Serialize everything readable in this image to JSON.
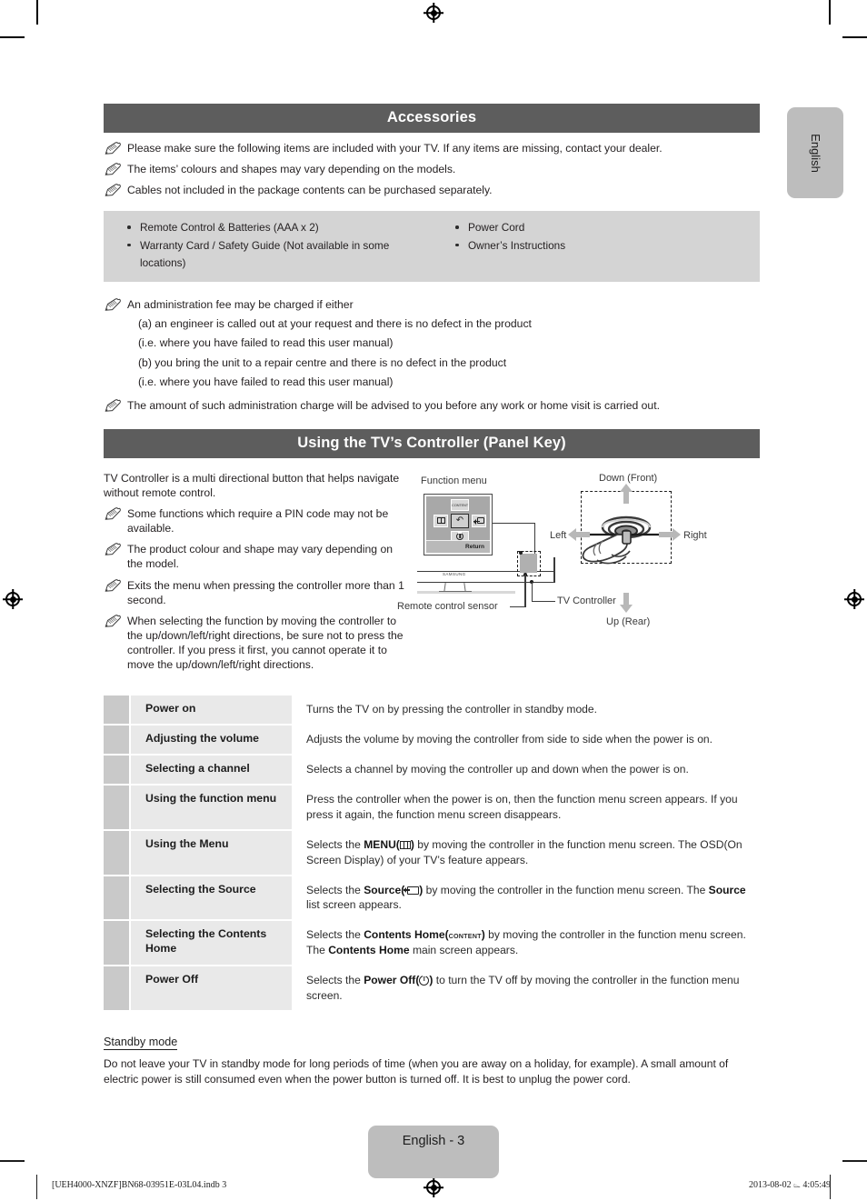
{
  "language_tab": "English",
  "accessories": {
    "title": "Accessories",
    "notes": [
      "Please make sure the following items are included with your TV. If any items are missing, contact your dealer.",
      "The items’ colours and shapes may vary depending on the models.",
      "Cables not included in the package contents can be purchased separately."
    ],
    "items_left": [
      "Remote Control & Batteries (AAA x 2)",
      "Warranty Card / Safety Guide (Not available in some locations)"
    ],
    "items_right": [
      "Power Cord",
      "Owner’s Instructions"
    ],
    "admin_fee_note": "An administration fee may be charged if either",
    "admin_fee_lines": [
      "(a) an engineer is called out at your request and there is no defect in the product",
      "(i.e. where you have failed to read this user manual)",
      "(b) you bring the unit to a repair centre and there is no defect in the product",
      "(i.e. where you have failed to read this user manual)"
    ],
    "admin_charge_note": "The amount of such administration charge will be advised to you before any work or home visit is carried out."
  },
  "controller": {
    "title": "Using the TV’s Controller (Panel Key)",
    "lead": "TV Controller is a multi directional button that helps navigate without remote control.",
    "notes": [
      "Some functions which require a PIN code may not be available.",
      "The product colour and shape may vary depending on the model.",
      "Exits the menu when pressing the controller more than 1 second.",
      "When selecting the function by moving the controller to the up/down/left/right directions, be sure not to press the controller. If you press it first, you cannot operate it to move the up/down/left/right directions."
    ],
    "diagram": {
      "function_menu_label": "Function menu",
      "return_label": "Return",
      "menu_key_top_label": "CONTENT",
      "remote_sensor_label": "Remote control sensor",
      "tv_controller_label": "TV Controller",
      "brand_label": "SAMSUNG",
      "direction_down": "Down (Front)",
      "direction_up": "Up (Rear)",
      "direction_left": "Left",
      "direction_right": "Right"
    }
  },
  "function_table": [
    {
      "label": "Power on",
      "desc_parts": [
        {
          "t": "text",
          "v": "Turns the TV on by pressing the controller in standby mode."
        }
      ]
    },
    {
      "label": "Adjusting the volume",
      "desc_parts": [
        {
          "t": "text",
          "v": "Adjusts the volume by moving the controller from side to side when the power is on."
        }
      ]
    },
    {
      "label": "Selecting a channel",
      "desc_parts": [
        {
          "t": "text",
          "v": "Selects a channel by moving the controller up and down when the power is on."
        }
      ]
    },
    {
      "label": "Using the function menu",
      "desc_parts": [
        {
          "t": "text",
          "v": "Press the controller when the power is on, then the function menu screen appears. If you press it again, the function menu screen disappears."
        }
      ]
    },
    {
      "label": "Using the Menu",
      "desc_parts": [
        {
          "t": "text",
          "v": "Selects the "
        },
        {
          "t": "b",
          "v": "MENU("
        },
        {
          "t": "icon",
          "v": "menu-icon"
        },
        {
          "t": "b",
          "v": ")"
        },
        {
          "t": "text",
          "v": " by moving the controller in the function menu screen. The OSD(On Screen Display) of your TV’s feature appears."
        }
      ]
    },
    {
      "label": "Selecting the Source",
      "desc_parts": [
        {
          "t": "text",
          "v": "Selects the "
        },
        {
          "t": "b",
          "v": "Source("
        },
        {
          "t": "icon",
          "v": "source-icon"
        },
        {
          "t": "b",
          "v": ")"
        },
        {
          "t": "text",
          "v": " by moving the controller in the function menu screen. The "
        },
        {
          "t": "b",
          "v": "Source"
        },
        {
          "t": "text",
          "v": " list screen appears."
        }
      ]
    },
    {
      "label": "Selecting the Contents Home",
      "desc_parts": [
        {
          "t": "text",
          "v": "Selects the "
        },
        {
          "t": "b",
          "v": "Contents Home("
        },
        {
          "t": "icon",
          "v": "content-icon"
        },
        {
          "t": "b",
          "v": ")"
        },
        {
          "t": "text",
          "v": " by moving the controller in the function menu screen. The "
        },
        {
          "t": "b",
          "v": "Contents Home"
        },
        {
          "t": "text",
          "v": " main screen appears."
        }
      ]
    },
    {
      "label": "Power Off",
      "desc_parts": [
        {
          "t": "text",
          "v": "Selects the "
        },
        {
          "t": "b",
          "v": "Power Off("
        },
        {
          "t": "icon",
          "v": "power-icon"
        },
        {
          "t": "b",
          "v": ")"
        },
        {
          "t": "text",
          "v": " to turn the TV off by moving the controller in the function menu screen."
        }
      ]
    }
  ],
  "standby": {
    "heading": "Standby mode",
    "body": "Do not leave your TV in standby mode for long periods of time (when you are away on a holiday, for example). A small amount of electric power is still consumed even when the power button is turned off. It is best to unplug the power cord."
  },
  "page_number_label": "English - 3",
  "footer": {
    "left": "[UEH4000-XNZF]BN68-03951E-03L04.indb   3",
    "right": "2013-08-02   ⌳ 4:05:49"
  },
  "colors": {
    "header_bar": "#5d5d5d",
    "accessory_box": "#d4d4d4",
    "table_strip": "#c9c9c9",
    "table_label": "#e9e9e9",
    "pill": "#bdbdbd"
  }
}
